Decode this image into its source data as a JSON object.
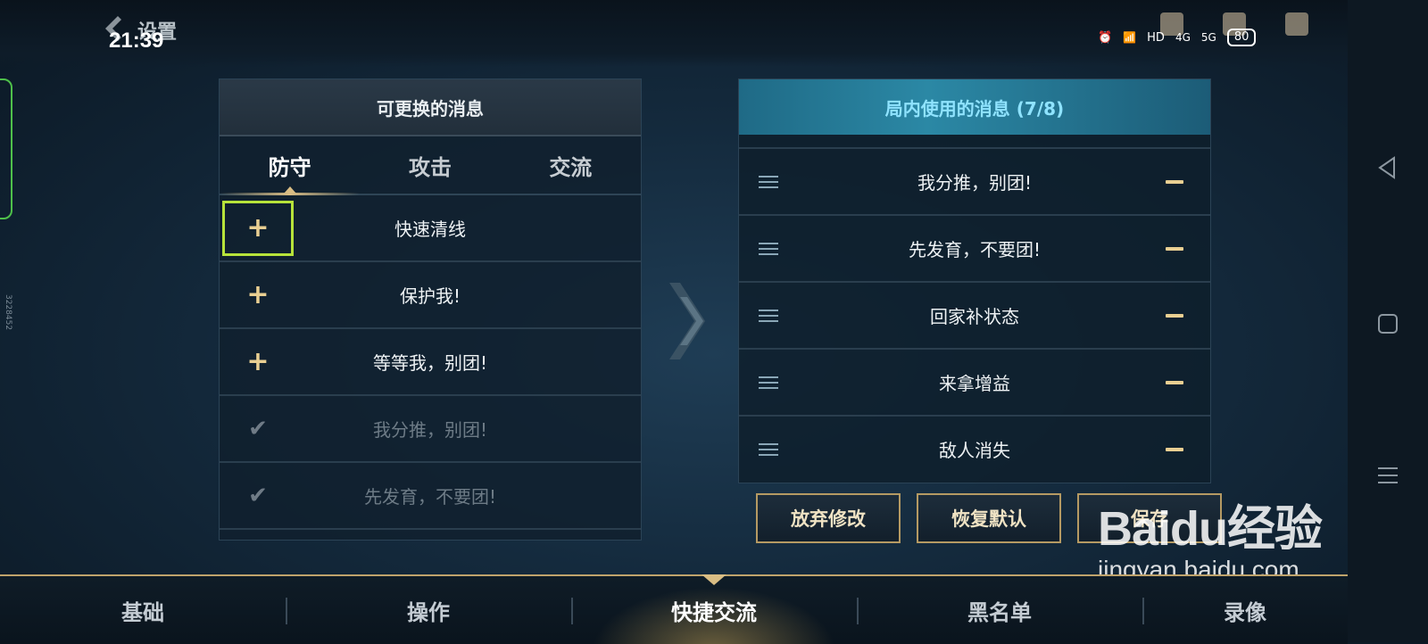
{
  "header": {
    "title": "设置",
    "clock": "21:39",
    "battery": "80",
    "net1": "4G",
    "net2": "5G",
    "hd": "HD"
  },
  "left_panel": {
    "title": "可更换的消息",
    "tabs": [
      {
        "label": "防守",
        "active": true
      },
      {
        "label": "攻击"
      },
      {
        "label": "交流"
      }
    ],
    "items": [
      {
        "label": "快速清线",
        "state": "add",
        "focused": true
      },
      {
        "label": "保护我!",
        "state": "add"
      },
      {
        "label": "等等我，别团!",
        "state": "add"
      },
      {
        "label": "我分推，别团!",
        "state": "added"
      },
      {
        "label": "先发育，不要团!",
        "state": "added"
      }
    ]
  },
  "right_panel": {
    "title": "局内使用的消息 (7/8)",
    "items": [
      {
        "label": "我分推，别团!"
      },
      {
        "label": "先发育，不要团!"
      },
      {
        "label": "回家补状态"
      },
      {
        "label": "来拿增益"
      },
      {
        "label": "敌人消失"
      }
    ]
  },
  "buttons": {
    "discard": "放弃修改",
    "restore": "恢复默认",
    "save": "保存"
  },
  "bottom_tabs": [
    {
      "label": "基础"
    },
    {
      "label": "操作"
    },
    {
      "label": "快捷交流",
      "active": true
    },
    {
      "label": "黑名单"
    },
    {
      "label": "录像"
    }
  ],
  "side_text": "3228452",
  "watermark": {
    "logo": "Baidu经验",
    "url": "jingyan.baidu.com"
  },
  "colors": {
    "gold": "#d9bd84",
    "focus": "#b7e33a",
    "accent_head": "#2b88a5"
  }
}
